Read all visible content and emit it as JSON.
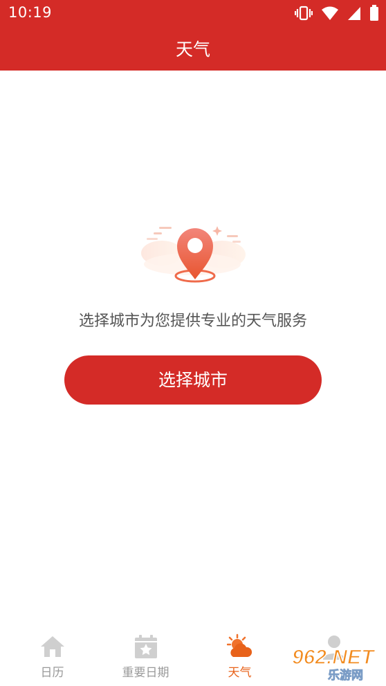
{
  "status_bar": {
    "time": "10:19",
    "icons": [
      "vibrate-icon",
      "wifi-icon",
      "signal-icon",
      "battery-icon"
    ]
  },
  "app_bar": {
    "title": "天气"
  },
  "empty_state": {
    "illustration": "location-pin-illustration",
    "message": "选择城市为您提供专业的天气服务",
    "button_label": "选择城市"
  },
  "bottom_nav": {
    "items": [
      {
        "label": "日历",
        "icon": "home-icon",
        "active": false
      },
      {
        "label": "重要日期",
        "icon": "calendar-star-icon",
        "active": false
      },
      {
        "label": "天气",
        "icon": "weather-icon",
        "active": true
      },
      {
        "label": "",
        "icon": "profile-icon",
        "active": false
      }
    ]
  },
  "watermark": {
    "brand": "962.NET",
    "sub": "乐游网"
  },
  "colors": {
    "primary": "#d42b27",
    "active_tab": "#e8621a",
    "inactive_tab": "#999999",
    "message_text": "#555555"
  }
}
